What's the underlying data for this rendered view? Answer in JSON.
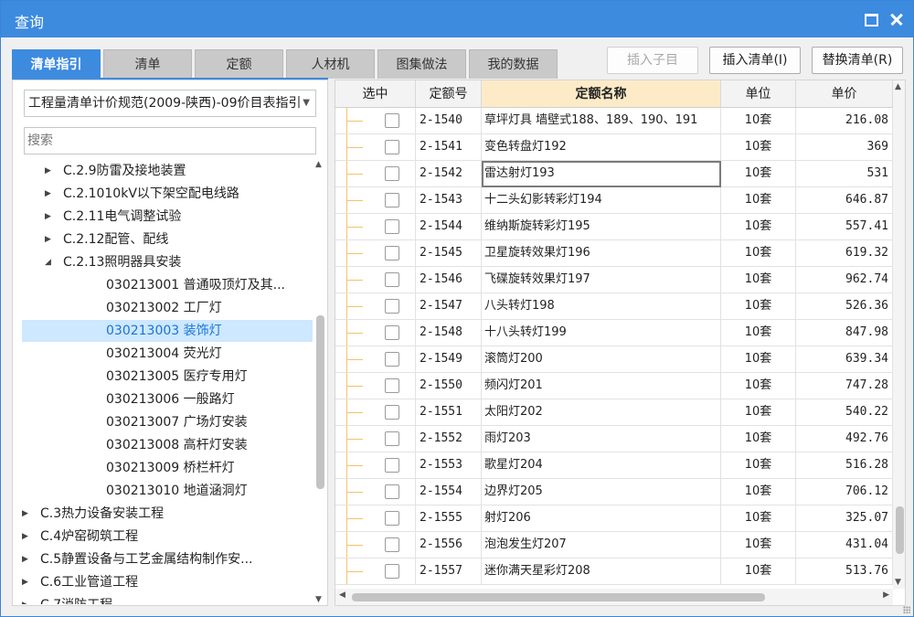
{
  "window": {
    "title": "查询"
  },
  "tabs": [
    {
      "label": "清单指引",
      "active": true
    },
    {
      "label": "清单",
      "active": false
    },
    {
      "label": "定额",
      "active": false
    },
    {
      "label": "人材机",
      "active": false
    },
    {
      "label": "图集做法",
      "active": false
    },
    {
      "label": "我的数据",
      "active": false
    }
  ],
  "toolbar": {
    "insert_child": "插入子目",
    "insert_list": "插入清单(I)",
    "replace_list": "替换清单(R)"
  },
  "left": {
    "selected_spec": "工程量清单计价规范(2009-陕西)-09价目表指引",
    "search_placeholder": "搜索",
    "tree": [
      {
        "label": "C.2.9防雷及接地装置",
        "level": 2,
        "expander": "collapsed"
      },
      {
        "label": "C.2.1010kV以下架空配电线路",
        "level": 2,
        "expander": "collapsed"
      },
      {
        "label": "C.2.11电气调整试验",
        "level": 2,
        "expander": "collapsed"
      },
      {
        "label": "C.2.12配管、配线",
        "level": 2,
        "expander": "collapsed"
      },
      {
        "label": "C.2.13照明器具安装",
        "level": 2,
        "expander": "expanded"
      },
      {
        "label": "030213001  普通吸顶灯及其...",
        "level": 3,
        "expander": "none"
      },
      {
        "label": "030213002  工厂灯",
        "level": 3,
        "expander": "none"
      },
      {
        "label": "030213003  装饰灯",
        "level": 3,
        "expander": "none",
        "selected": true
      },
      {
        "label": "030213004  荧光灯",
        "level": 3,
        "expander": "none"
      },
      {
        "label": "030213005  医疗专用灯",
        "level": 3,
        "expander": "none"
      },
      {
        "label": "030213006  一般路灯",
        "level": 3,
        "expander": "none"
      },
      {
        "label": "030213007  广场灯安装",
        "level": 3,
        "expander": "none"
      },
      {
        "label": "030213008  高杆灯安装",
        "level": 3,
        "expander": "none"
      },
      {
        "label": "030213009  桥栏杆灯",
        "level": 3,
        "expander": "none"
      },
      {
        "label": "030213010  地道涵洞灯",
        "level": 3,
        "expander": "none"
      },
      {
        "label": "C.3热力设备安装工程",
        "level": 1,
        "expander": "collapsed"
      },
      {
        "label": "C.4炉窑砌筑工程",
        "level": 1,
        "expander": "collapsed"
      },
      {
        "label": "C.5静置设备与工艺金属结构制作安...",
        "level": 1,
        "expander": "collapsed"
      },
      {
        "label": "C.6工业管道工程",
        "level": 1,
        "expander": "collapsed"
      },
      {
        "label": "C.7消防工程",
        "level": 1,
        "expander": "collapsed"
      }
    ]
  },
  "grid": {
    "headers": [
      "选中",
      "定额号",
      "定额名称",
      "单位",
      "单价"
    ],
    "rows": [
      {
        "code": "2-1540",
        "name": "草坪灯具 墙壁式188、189、190、191",
        "unit": "10套",
        "price": "216.08"
      },
      {
        "code": "2-1541",
        "name": "变色转盘灯192",
        "unit": "10套",
        "price": "369"
      },
      {
        "code": "2-1542",
        "name": "雷达射灯193",
        "unit": "10套",
        "price": "531"
      },
      {
        "code": "2-1543",
        "name": "十二头幻影转彩灯194",
        "unit": "10套",
        "price": "646.87"
      },
      {
        "code": "2-1544",
        "name": "维纳斯旋转彩灯195",
        "unit": "10套",
        "price": "557.41"
      },
      {
        "code": "2-1545",
        "name": "卫星旋转效果灯196",
        "unit": "10套",
        "price": "619.32"
      },
      {
        "code": "2-1546",
        "name": "飞碟旋转效果灯197",
        "unit": "10套",
        "price": "962.74"
      },
      {
        "code": "2-1547",
        "name": "八头转灯198",
        "unit": "10套",
        "price": "526.36"
      },
      {
        "code": "2-1548",
        "name": "十八头转灯199",
        "unit": "10套",
        "price": "847.98"
      },
      {
        "code": "2-1549",
        "name": "滚筒灯200",
        "unit": "10套",
        "price": "639.34"
      },
      {
        "code": "2-1550",
        "name": "频闪灯201",
        "unit": "10套",
        "price": "747.28"
      },
      {
        "code": "2-1551",
        "name": "太阳灯202",
        "unit": "10套",
        "price": "540.22"
      },
      {
        "code": "2-1552",
        "name": "雨灯203",
        "unit": "10套",
        "price": "492.76"
      },
      {
        "code": "2-1553",
        "name": "歌星灯204",
        "unit": "10套",
        "price": "516.28"
      },
      {
        "code": "2-1554",
        "name": "边界灯205",
        "unit": "10套",
        "price": "706.12"
      },
      {
        "code": "2-1555",
        "name": "射灯206",
        "unit": "10套",
        "price": "325.07"
      },
      {
        "code": "2-1556",
        "name": "泡泡发生灯207",
        "unit": "10套",
        "price": "431.04"
      },
      {
        "code": "2-1557",
        "name": "迷你满天星彩灯208",
        "unit": "10套",
        "price": "513.76"
      }
    ],
    "focused_row": 2
  },
  "colors": {
    "accent": "#3d8bdf",
    "sorted_header": "#fdebc8",
    "selected_node": "#cde8ff"
  }
}
